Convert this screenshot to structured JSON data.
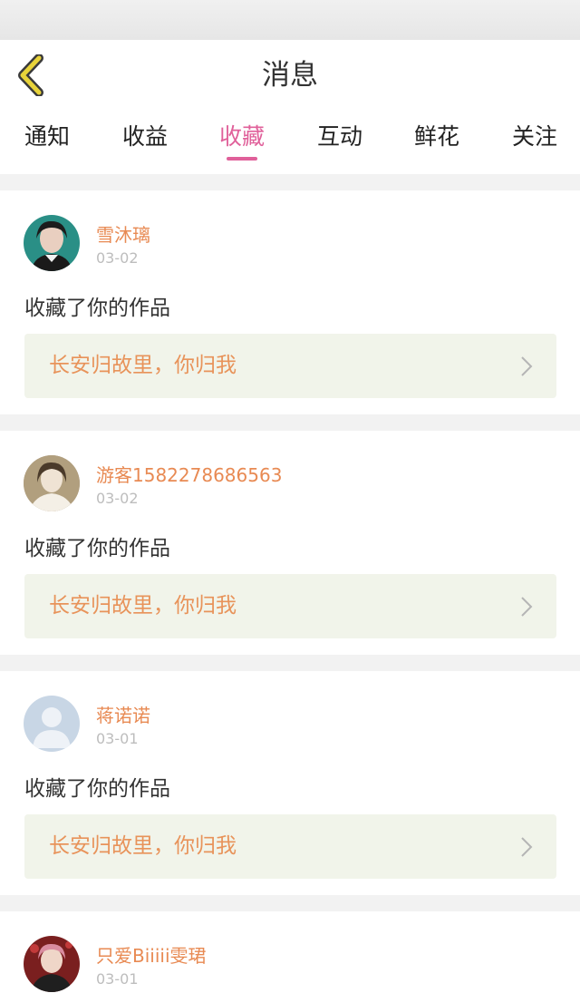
{
  "header": {
    "title": "消息"
  },
  "tabs": [
    {
      "label": "通知",
      "active": false
    },
    {
      "label": "收益",
      "active": false
    },
    {
      "label": "收藏",
      "active": true
    },
    {
      "label": "互动",
      "active": false
    },
    {
      "label": "鲜花",
      "active": false
    },
    {
      "label": "关注",
      "active": false
    }
  ],
  "colors": {
    "accent": "#e0609a",
    "username": "#e88a53",
    "work_title": "#e8935a",
    "work_bg": "#f1f4ea",
    "back_arrow": "#e8d33a"
  },
  "messages": [
    {
      "username": "雪沐璃",
      "date": "03-02",
      "action": "收藏了你的作品",
      "work_title": "长安归故里，你归我",
      "avatar": "photo-avatar"
    },
    {
      "username": "游客1582278686563",
      "date": "03-02",
      "action": "收藏了你的作品",
      "work_title": "长安归故里，你归我",
      "avatar": "photo-avatar"
    },
    {
      "username": "蒋诺诺",
      "date": "03-01",
      "action": "收藏了你的作品",
      "work_title": "长安归故里，你归我",
      "avatar": "default-avatar"
    },
    {
      "username": "只爱Biiiii雯珺",
      "date": "03-01",
      "action": "",
      "work_title": "",
      "avatar": "photo-avatar"
    }
  ]
}
